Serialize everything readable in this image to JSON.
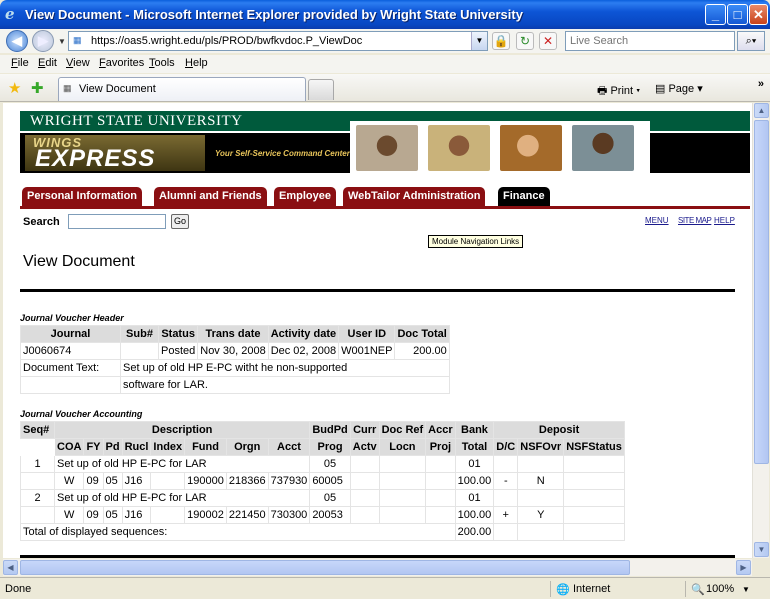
{
  "window": {
    "title": "View Document - Microsoft Internet Explorer provided by Wright State University",
    "url": "https://oas5.wright.edu/pls/PROD/bwfkvdoc.P_ViewDoc",
    "search_placeholder": "Live Search",
    "menu": [
      "File",
      "Edit",
      "View",
      "Favorites",
      "Tools",
      "Help"
    ],
    "tab_label": "View Document",
    "print_label": "Print",
    "page_label": "Page",
    "status_text": "Done",
    "zone": "Internet",
    "zoom": "100%"
  },
  "banner": {
    "university": "WRIGHT STATE UNIVERSITY",
    "wings": "WINGS",
    "express": "EXPRESS",
    "tagline": "Your Self-Service Command Center"
  },
  "nav_tabs": [
    "Personal Information",
    "Alumni and Friends",
    "Employee",
    "WebTailor Administration",
    "Finance"
  ],
  "search": {
    "label": "Search",
    "go": "Go"
  },
  "top_links": [
    "MENU",
    "SITE MAP",
    "HELP"
  ],
  "tooltip": "Module Navigation Links",
  "page_title": "View Document",
  "jv_header": {
    "caption": "Journal Voucher Header",
    "columns": [
      "Journal",
      "Sub#",
      "Status",
      "Trans date",
      "Activity date",
      "User ID",
      "Doc Total"
    ],
    "row": [
      "J0060674",
      "",
      "Posted",
      "Nov 30, 2008",
      "Dec 02, 2008",
      "W001NEP",
      "200.00"
    ],
    "doc_text_label": "Document Text:",
    "doc_text_1": "Set up of old HP E-PC witht he non-supported",
    "doc_text_2": "software for LAR."
  },
  "jv_accounting": {
    "caption": "Journal Voucher Accounting",
    "head1": [
      "Seq#",
      "Description",
      "BudPd",
      "Curr",
      "Doc Ref",
      "Accr",
      "Bank",
      "Deposit"
    ],
    "head2": [
      "COA",
      "FY",
      "Pd",
      "Rucl",
      "Index",
      "Fund",
      "Orgn",
      "Acct",
      "Prog",
      "Actv",
      "Locn",
      "Proj",
      "Total",
      "D/C",
      "NSFOvr",
      "NSFStatus"
    ],
    "rows": [
      {
        "seq": "1",
        "desc": "Set up of old HP E-PC for LAR",
        "budpd": "05",
        "bank": "01",
        "coa": "W",
        "fy": "09",
        "pd": "05",
        "rucl": "J16",
        "index": "",
        "fund": "190000",
        "orgn": "218366",
        "acct": "737930",
        "prog": "60005",
        "total": "100.00",
        "dc": "-",
        "nsfovr": "N",
        "nsfstatus": ""
      },
      {
        "seq": "2",
        "desc": "Set up of old HP E-PC for LAR",
        "budpd": "05",
        "bank": "01",
        "coa": "W",
        "fy": "09",
        "pd": "05",
        "rucl": "J16",
        "index": "",
        "fund": "190002",
        "orgn": "221450",
        "acct": "730300",
        "prog": "20053",
        "total": "100.00",
        "dc": "+",
        "nsfovr": "Y",
        "nsfstatus": ""
      }
    ],
    "total_label": "Total of displayed sequences:",
    "total_value": "200.00"
  }
}
